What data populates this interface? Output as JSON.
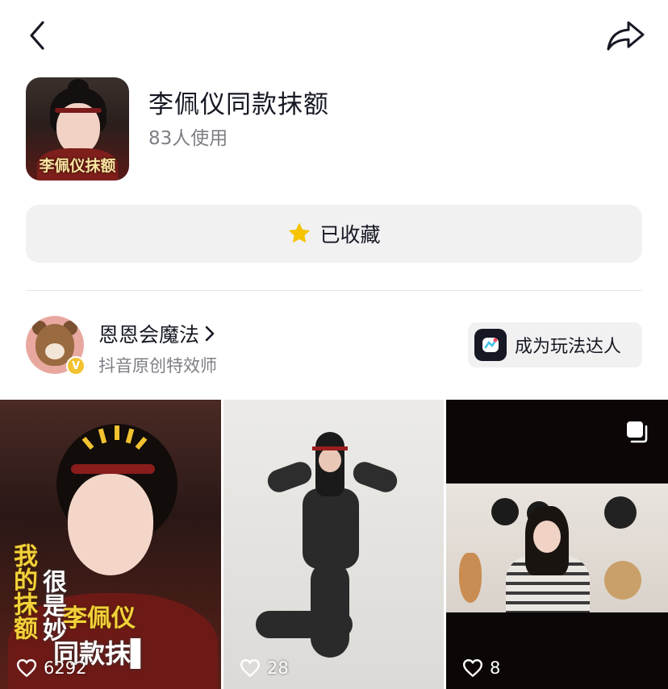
{
  "effect": {
    "title": "李佩仪同款抹额",
    "usage": "83人使用",
    "thumb_label": "李佩仪抹额"
  },
  "favorite": {
    "label": "已收藏",
    "icon": "star-icon",
    "color": "#f5c300"
  },
  "creator": {
    "name": "恩恩会魔法",
    "role": "抖音原创特效师",
    "verified_color": "#f2c230",
    "become_label": "成为玩法达人"
  },
  "videos": [
    {
      "likes": "6292",
      "overlay_vertical_1": "我的抹额",
      "overlay_vertical_2": "很是妙",
      "overlay_line_1": "李佩仪",
      "overlay_line_2": "同款抹▌"
    },
    {
      "likes": "28"
    },
    {
      "likes": "8",
      "multi_icon": "multi-image-icon"
    }
  ]
}
